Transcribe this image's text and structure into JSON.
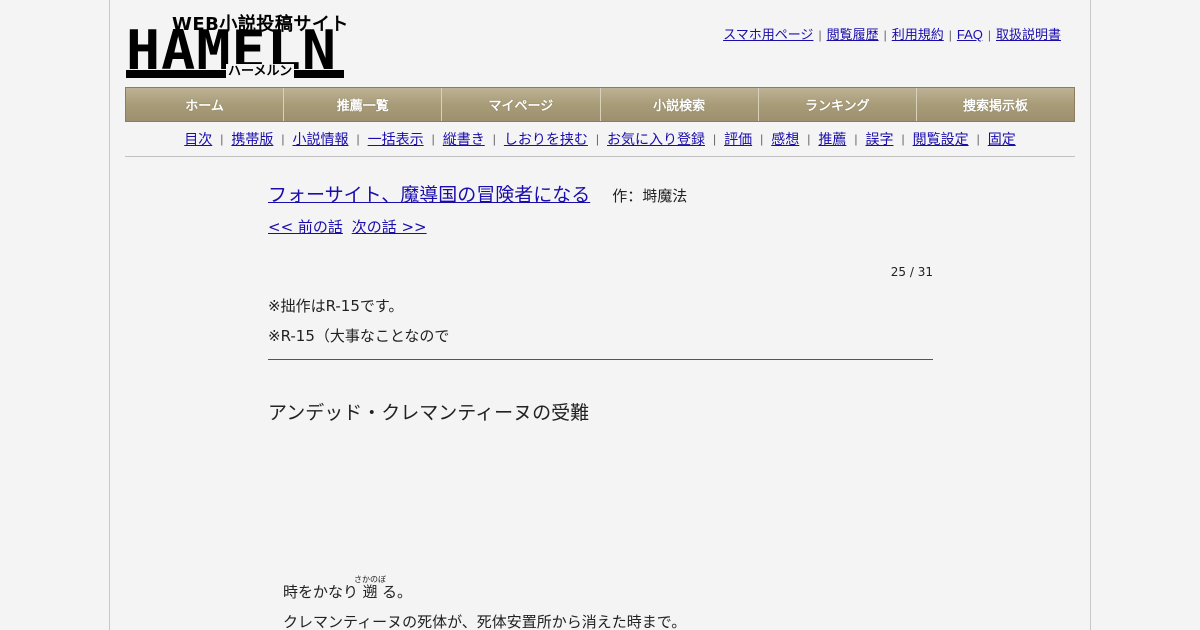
{
  "logo": {
    "tagline": "WEB小説投稿サイト",
    "name": "HAMELN",
    "kana": "ハーメルン"
  },
  "top_links": [
    "スマホ用ページ",
    "閲覧履歴",
    "利用規約",
    "FAQ",
    "取扱説明書"
  ],
  "nav_tabs": [
    "ホーム",
    "推薦一覧",
    "マイページ",
    "小説検索",
    "ランキング",
    "捜索掲示板"
  ],
  "sub_nav": [
    "目次",
    "携帯版",
    "小説情報",
    "一括表示",
    "縦書き",
    "しおりを挟む",
    "お気に入り登録",
    "評価",
    "感想",
    "推薦",
    "誤字",
    "閲覧設定",
    "固定"
  ],
  "novel": {
    "title": "フォーサイト、魔導国の冒険者になる",
    "author": "作：塒魔法",
    "prev_link": "<< 前の話",
    "next_link": "次の話 >>",
    "counter": "25 / 31",
    "notes": [
      "※拙作はR-15です。",
      "※R-15（大事なことなので"
    ],
    "chapter_title": "アンデッド・クレマンティーヌの受難",
    "body": {
      "line1_before": "時をかなり",
      "line1_ruby_base": "遡",
      "line1_ruby_text": "さかのぼ",
      "line1_after": "る。",
      "line2": "クレマンティーヌの死体が、死体安置所から消えた時まで。"
    }
  }
}
